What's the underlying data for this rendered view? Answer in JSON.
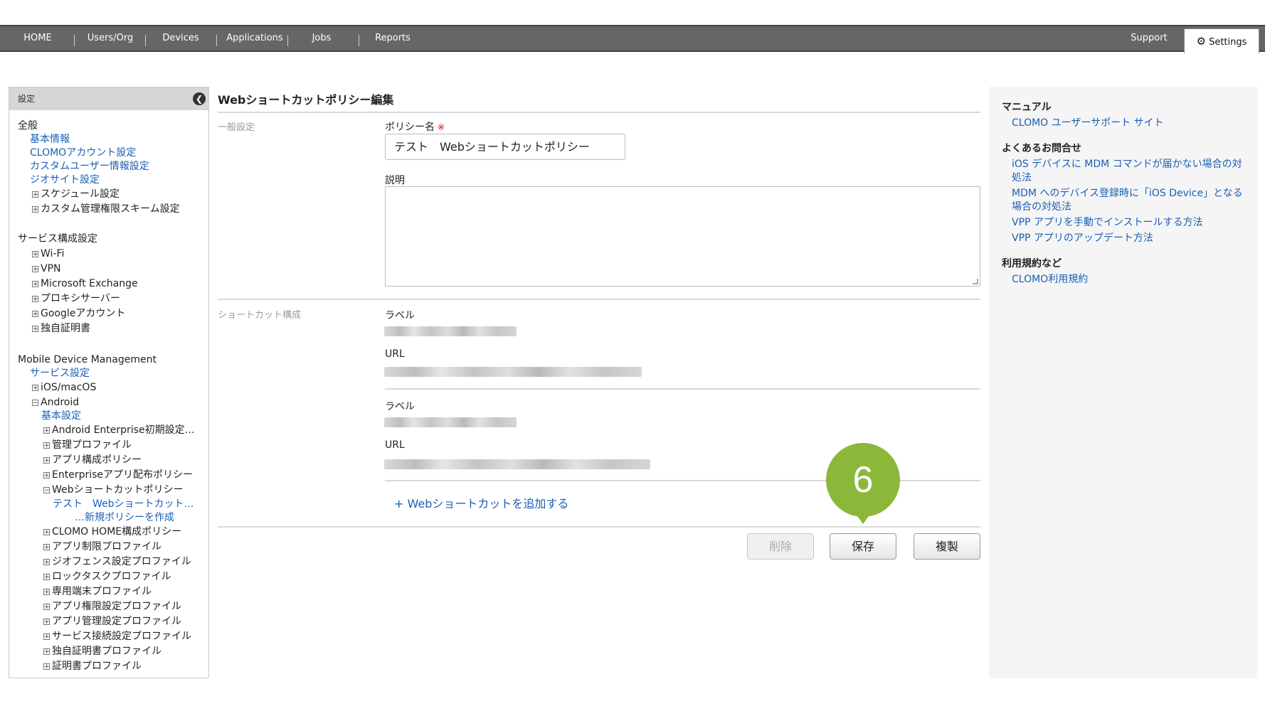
{
  "nav": {
    "items": [
      "HOME",
      "Users/Org",
      "Devices",
      "Applications",
      "Jobs",
      "Reports"
    ],
    "support": "Support",
    "settings": "Settings"
  },
  "sidebar": {
    "header": "設定",
    "general_title": "全般",
    "general_links": [
      "基本情報",
      "CLOMOアカウント設定",
      "カスタムユーザー情報設定",
      "ジオサイト設定"
    ],
    "general_expand": [
      "スケジュール設定",
      "カスタム管理権限スキーム設定"
    ],
    "service_title": "サービス構成設定",
    "service_items": [
      "Wi-Fi",
      "VPN",
      "Microsoft Exchange",
      "プロキシサーバー",
      "Googleアカウント",
      "独自証明書"
    ],
    "mdm_title": "Mobile Device Management",
    "mdm_link": "サービス設定",
    "ios": "iOS/macOS",
    "android": "Android",
    "android_basic": "基本設定",
    "android_items_a": [
      "Android Enterprise初期設定…",
      "管理プロファイル",
      "アプリ構成ポリシー",
      "Enterpriseアプリ配布ポリシー"
    ],
    "web_shortcut": "Webショートカットポリシー",
    "web_shortcut_sub": [
      "テスト　Webショートカット…",
      "…新規ポリシーを作成"
    ],
    "android_items_b": [
      "CLOMO HOME構成ポリシー",
      "アプリ制限プロファイル",
      "ジオフェンス設定プロファイル",
      "ロックタスクプロファイル",
      "専用端末プロファイル",
      "アプリ権限設定プロファイル",
      "アプリ管理設定プロファイル",
      "サービス接続設定プロファイル",
      "独自証明書プロファイル",
      "証明書プロファイル"
    ]
  },
  "main": {
    "title": "Webショートカットポリシー編集",
    "general_section": "一般設定",
    "policy_name_label": "ポリシー名",
    "required_mark": "※",
    "policy_name_value": "テスト　Webショートカットポリシー",
    "description_label": "説明",
    "shortcut_section": "ショートカット構成",
    "label_label": "ラベル",
    "url_label": "URL",
    "add_shortcut": "+ Webショートカットを追加する",
    "buttons": {
      "delete": "削除",
      "save": "保存",
      "duplicate": "複製"
    },
    "step_marker": "6"
  },
  "help": {
    "manual_title": "マニュアル",
    "manual_link": "CLOMO ユーザーサポート サイト",
    "faq_title": "よくあるお問合せ",
    "faq_links": [
      "iOS デバイスに MDM コマンドが届かない場合の対",
      "処法",
      "MDM へのデバイス登録時に「iOS Device」となる",
      "場合の対処法",
      "VPP アプリを手動でインストールする方法",
      "VPP アプリのアップデート方法"
    ],
    "terms_title": "利用規約など",
    "terms_link": "CLOMO利用規約"
  }
}
